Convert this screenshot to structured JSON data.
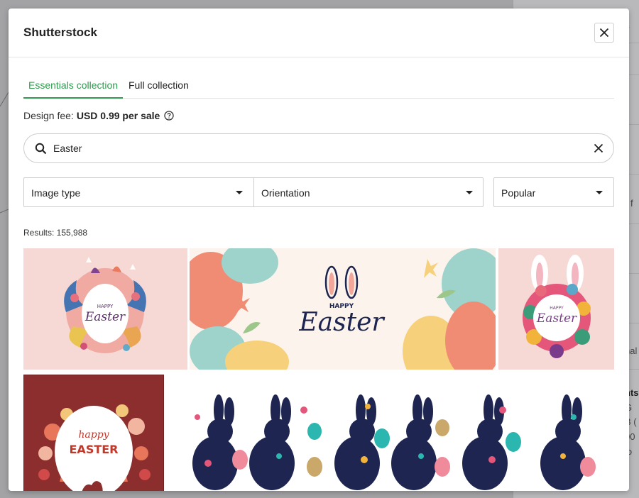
{
  "modal": {
    "title": "Shutterstock",
    "close_label": "Close"
  },
  "tabs": [
    {
      "label": "Essentials collection",
      "active": true
    },
    {
      "label": "Full collection",
      "active": false
    }
  ],
  "fee": {
    "label": "Design fee:",
    "amount": "USD 0.99 per sale"
  },
  "search": {
    "value": "Easter",
    "placeholder": "Search"
  },
  "filters": {
    "image_type": "Image type",
    "orientation": "Orientation",
    "sort": "Popular"
  },
  "results": {
    "label": "Results: 155,988"
  },
  "images": [
    {
      "text_small": "HAPPY",
      "text_big": "Easter"
    },
    {
      "text_small": "HAPPY",
      "text_big": "Easter"
    },
    {
      "text_small": "HAPPY",
      "text_big": "Easter"
    },
    {
      "text_small": "happy",
      "text_big": "EASTER"
    },
    {
      "text_small": "",
      "text_big": ""
    }
  ],
  "colors": {
    "accent": "#2e9b4e",
    "pink_bg": "#f6d9d4",
    "cream_bg": "#fcf4ec",
    "maroon_bg": "#8c2e2e",
    "navy": "#1d2550"
  },
  "icons": {
    "close": "close-icon",
    "help": "question-circle-icon",
    "search": "search-icon",
    "clear": "clear-icon",
    "caret": "caret-down-icon"
  },
  "background_page": {
    "snippets": [
      "y",
      "r f",
      "hal",
      "nts",
      "G",
      "B (",
      "00",
      "io"
    ]
  }
}
